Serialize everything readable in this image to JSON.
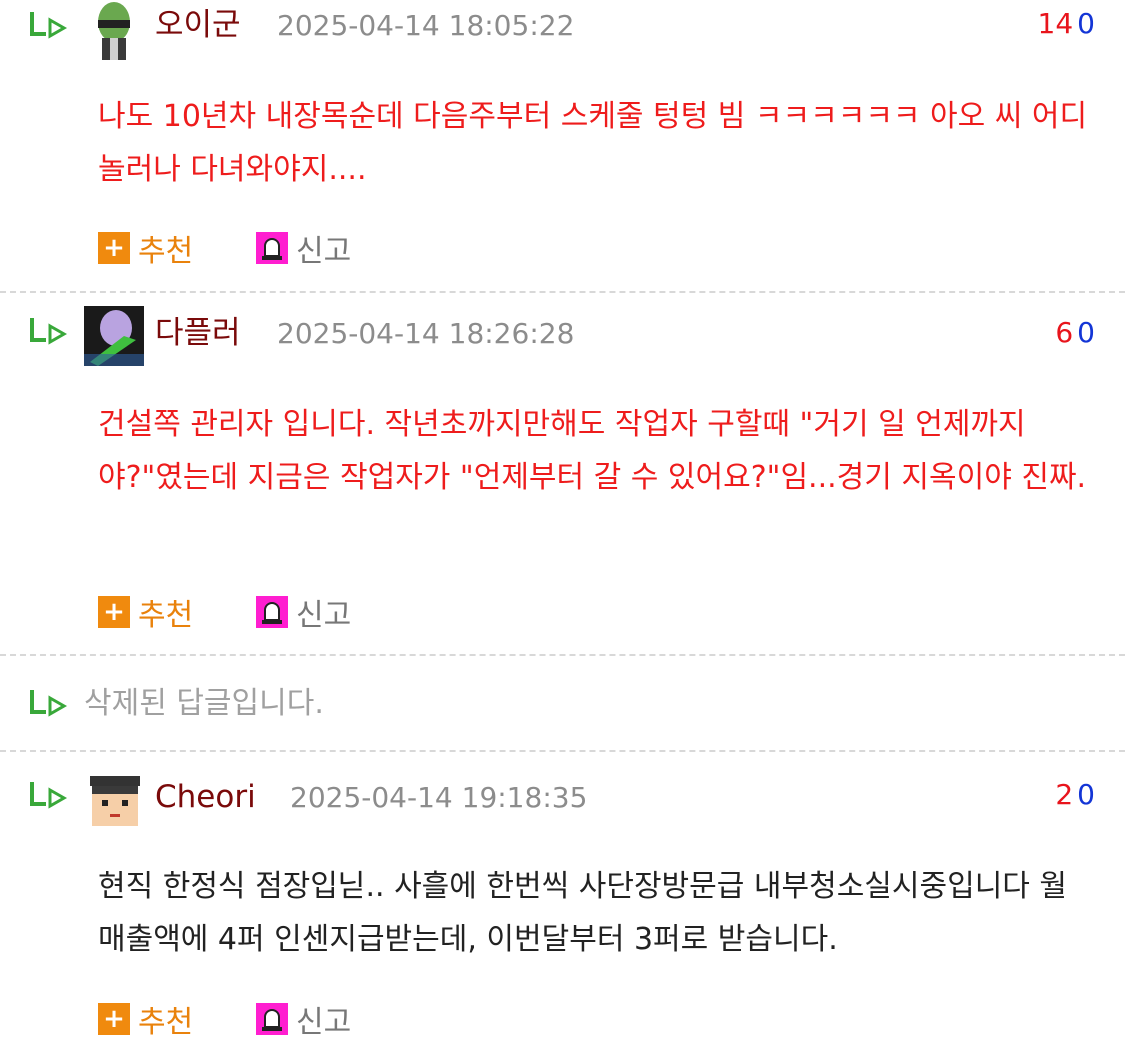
{
  "comments": [
    {
      "nick": "오이군",
      "time": "2025-04-14 18:05:22",
      "up": "14",
      "down": "0",
      "body": "나도 10년차 내장목순데 다음주부터 스케줄 텅텅 빔 ㅋㅋㅋㅋㅋㅋ 아오 씨 어디 놀러나 다녀와야지....",
      "body_color": "#ee1c1c",
      "recommend_label": "추천",
      "report_label": "신고"
    },
    {
      "nick": "다플러",
      "time": "2025-04-14 18:26:28",
      "up": "6",
      "down": "0",
      "body": "건설쪽 관리자 입니다. 작년초까지만해도 작업자 구할때 \"거기 일 언제까지야?\"였는데 지금은 작업자가 \"언제부터 갈 수 있어요?\"임...경기 지옥이야 진짜.",
      "body_color": "#ee1c1c",
      "recommend_label": "추천",
      "report_label": "신고"
    },
    {
      "deleted_text": "삭제된 답글입니다."
    },
    {
      "nick": "Cheori",
      "time": "2025-04-14 19:18:35",
      "up": "2",
      "down": "0",
      "body": "현직 한정식 점장입닏.. 사흘에 한번씩 사단장방문급 내부청소실시중입니다 월 매출액에 4퍼 인센지급받는데, 이번달부터 3퍼로 받습니다.",
      "body_color": "#222222",
      "recommend_label": "추천",
      "report_label": "신고"
    }
  ],
  "colors": {
    "nick": "#7a0a0a",
    "upvote": "#e8141c",
    "downvote": "#1335d6",
    "recommend_accent": "#f08a0e",
    "report_accent": "#ff1ed0",
    "reply_arrow": "#39a83a"
  },
  "icons": {
    "reply": "reply-arrow-icon",
    "recommend": "plus-icon",
    "report": "siren-icon"
  }
}
